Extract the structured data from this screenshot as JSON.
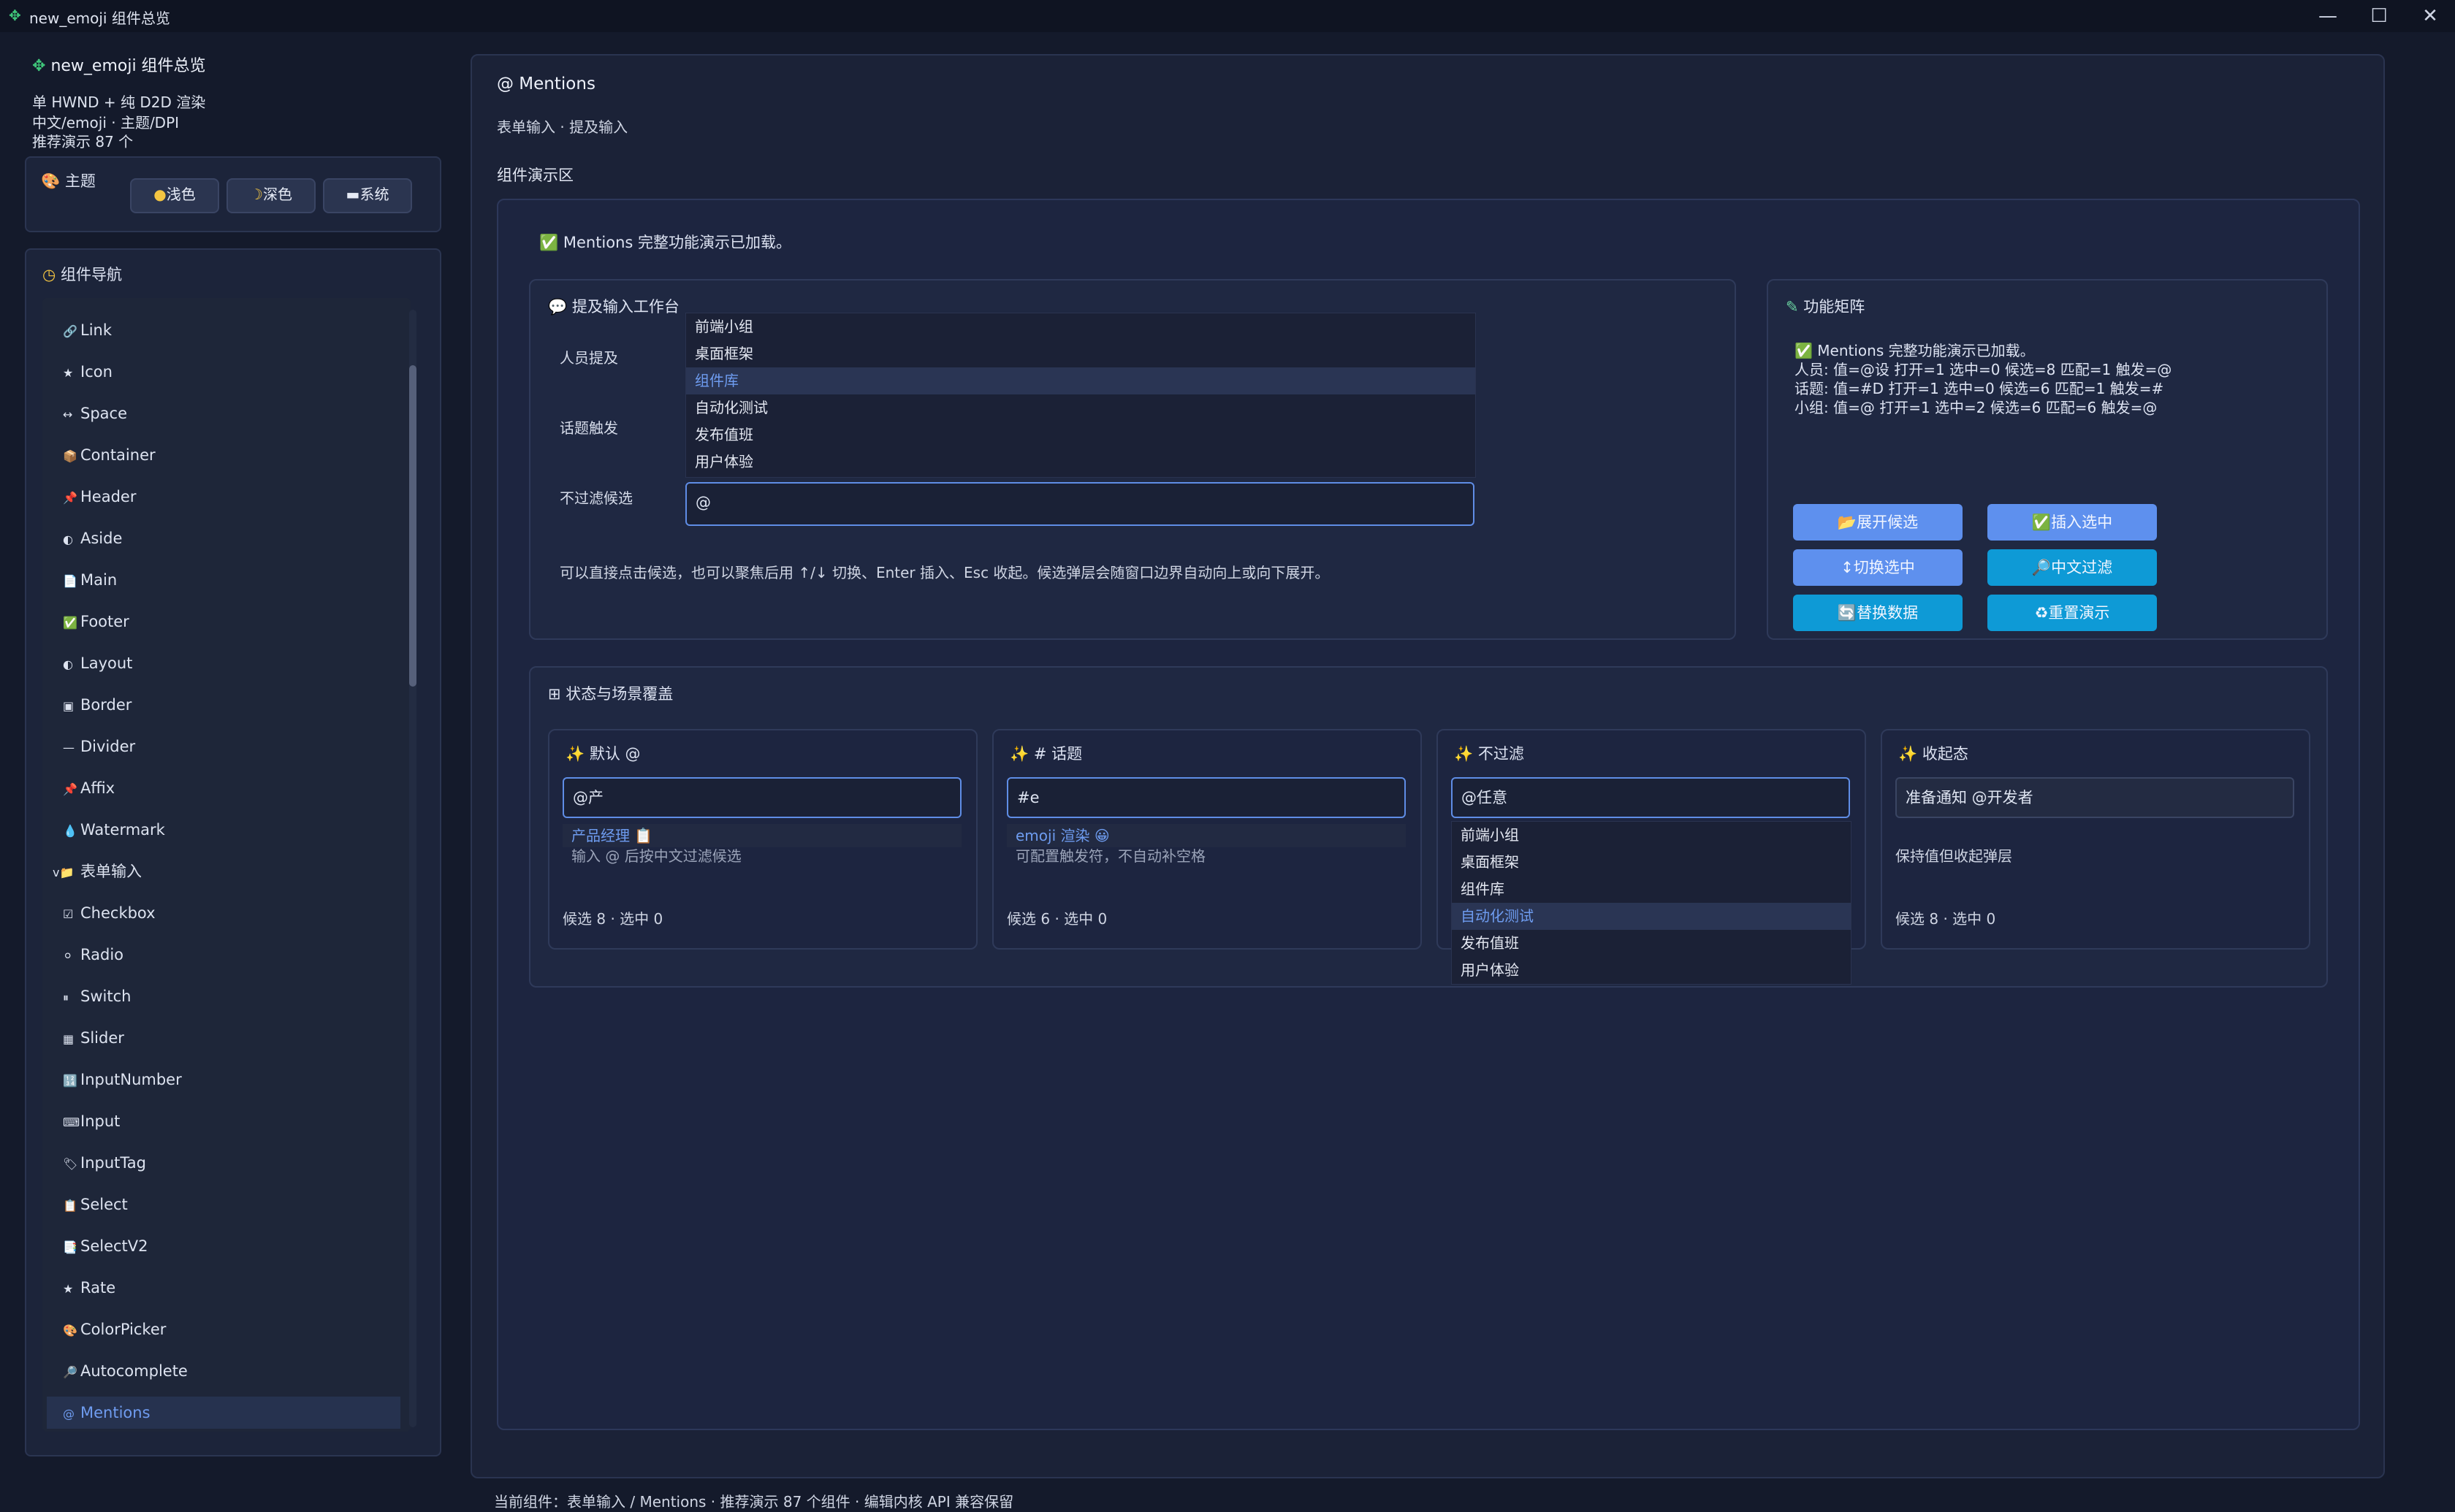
{
  "window": {
    "title": "new_emoji 组件总览",
    "controls": [
      "—",
      "☐",
      "✕"
    ]
  },
  "sidebar": {
    "app_title": "new_emoji 组件总览",
    "lines": [
      "单 HWND + 纯 D2D 渲染",
      "中文/emoji · 主题/DPI",
      "推荐演示 87 个"
    ],
    "theme": {
      "label": "主题",
      "buttons": [
        "浅色",
        "深色",
        "系统"
      ]
    },
    "nav_title": "组件导航",
    "items": [
      {
        "icon": "🔗",
        "label": "Link"
      },
      {
        "icon": "★",
        "label": "Icon"
      },
      {
        "icon": "↔",
        "label": "Space"
      },
      {
        "icon": "📦",
        "label": "Container"
      },
      {
        "icon": "📌",
        "label": "Header"
      },
      {
        "icon": "◐",
        "label": "Aside"
      },
      {
        "icon": "📄",
        "label": "Main"
      },
      {
        "icon": "✅",
        "label": "Footer"
      },
      {
        "icon": "◐",
        "label": "Layout"
      },
      {
        "icon": "▣",
        "label": "Border"
      },
      {
        "icon": "—",
        "label": "Divider"
      },
      {
        "icon": "📌",
        "label": "Affix"
      },
      {
        "icon": "💧",
        "label": "Watermark"
      },
      {
        "icon": "v📁",
        "label": "表单输入"
      },
      {
        "icon": "☑",
        "label": "Checkbox"
      },
      {
        "icon": "⚪",
        "label": "Radio"
      },
      {
        "icon": "⏸",
        "label": "Switch"
      },
      {
        "icon": "▦",
        "label": "Slider"
      },
      {
        "icon": "🔢",
        "label": "InputNumber"
      },
      {
        "icon": "⌨",
        "label": "Input"
      },
      {
        "icon": "🏷",
        "label": "InputTag"
      },
      {
        "icon": "📋",
        "label": "Select"
      },
      {
        "icon": "📑",
        "label": "SelectV2"
      },
      {
        "icon": "★",
        "label": "Rate"
      },
      {
        "icon": "🎨",
        "label": "ColorPicker"
      },
      {
        "icon": "🔎",
        "label": "Autocomplete"
      },
      {
        "icon": "@",
        "label": "Mentions"
      }
    ]
  },
  "main": {
    "title": "@ Mentions",
    "subtitle": "表单输入 · 提及输入",
    "area_label": "组件演示区",
    "loaded": "Mentions 完整功能演示已加载。",
    "workbench": {
      "title": "提及输入工作台",
      "rows": [
        "人员提及",
        "话题触发",
        "不过滤候选"
      ],
      "dropdown": [
        "前端小组",
        "桌面框架",
        "组件库",
        "自动化测试",
        "发布值班",
        "用户体验"
      ],
      "input_value": "@",
      "hint": "可以直接点击候选，也可以聚焦后用 ↑/↓ 切换、Enter 插入、Esc 收起。候选弹层会随窗口边界自动向上或向下展开。"
    },
    "matrix": {
      "title": "功能矩阵",
      "lines": [
        "Mentions 完整功能演示已加载。",
        "人员: 值=@设 打开=1 选中=0 候选=8 匹配=1 触发=@",
        "话题: 值=#D 打开=1 选中=0 候选=6 匹配=1 触发=#",
        "小组: 值=@ 打开=1 选中=2 候选=6 匹配=6 触发=@"
      ],
      "buttons": [
        "展开候选",
        "插入选中",
        "切换选中",
        "中文过滤",
        "替换数据",
        "重置演示"
      ]
    },
    "states": {
      "title": "状态与场景覆盖",
      "cards": [
        {
          "title": "默认 @",
          "input": "@产",
          "suggest": "产品经理 📋",
          "under": "输入 @ 后按中文过滤候选",
          "footer": "候选 8 · 选中 0"
        },
        {
          "title": "# 话题",
          "input": "#e",
          "suggest": "emoji 渲染 😀",
          "under": "可配置触发符，不自动补空格",
          "footer": "候选 6 · 选中 0"
        },
        {
          "title": "不过滤",
          "input": "@任意",
          "dropdown": [
            "前端小组",
            "桌面框架",
            "组件库",
            "自动化测试",
            "发布值班",
            "用户体验"
          ]
        },
        {
          "title": "收起态",
          "input": "准备通知 @开发者",
          "under": "保持值但收起弹层",
          "footer": "候选 8 · 选中 0"
        }
      ]
    }
  },
  "status_bar": "当前组件：表单输入 / Mentions · 推荐演示 87 个组件 · 编辑内核 API 兼容保留"
}
